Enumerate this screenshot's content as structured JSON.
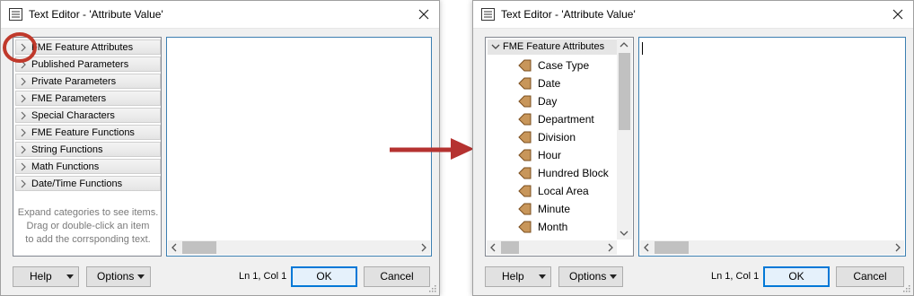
{
  "left_dialog": {
    "title": "Text Editor - 'Attribute Value'",
    "categories": [
      "FME Feature Attributes",
      "Published Parameters",
      "Private Parameters",
      "FME Parameters",
      "Special Characters",
      "FME Feature Functions",
      "String Functions",
      "Math Functions",
      "Date/Time Functions"
    ],
    "hint_lines": [
      "Expand categories to see items.",
      "Drag or double-click an item",
      "to add the corrsponding text."
    ],
    "help_label": "Help",
    "options_label": "Options",
    "status": "Ln 1, Col 1",
    "ok_label": "OK",
    "cancel_label": "Cancel"
  },
  "right_dialog": {
    "title": "Text Editor - 'Attribute Value'",
    "tree_root": "FME Feature Attributes",
    "attributes": [
      "Case Type",
      "Date",
      "Day",
      "Department",
      "Division",
      "Hour",
      "Hundred Block",
      "Local Area",
      "Minute",
      "Month"
    ],
    "help_label": "Help",
    "options_label": "Options",
    "status": "Ln 1, Col 1",
    "ok_label": "OK",
    "cancel_label": "Cancel"
  },
  "colors": {
    "highlight_circle": "#c0392b",
    "arrow": "#b53230",
    "attribute_icon": "#c8965a",
    "focus_border": "#3c7fb1",
    "primary_button_border": "#0078d7"
  }
}
